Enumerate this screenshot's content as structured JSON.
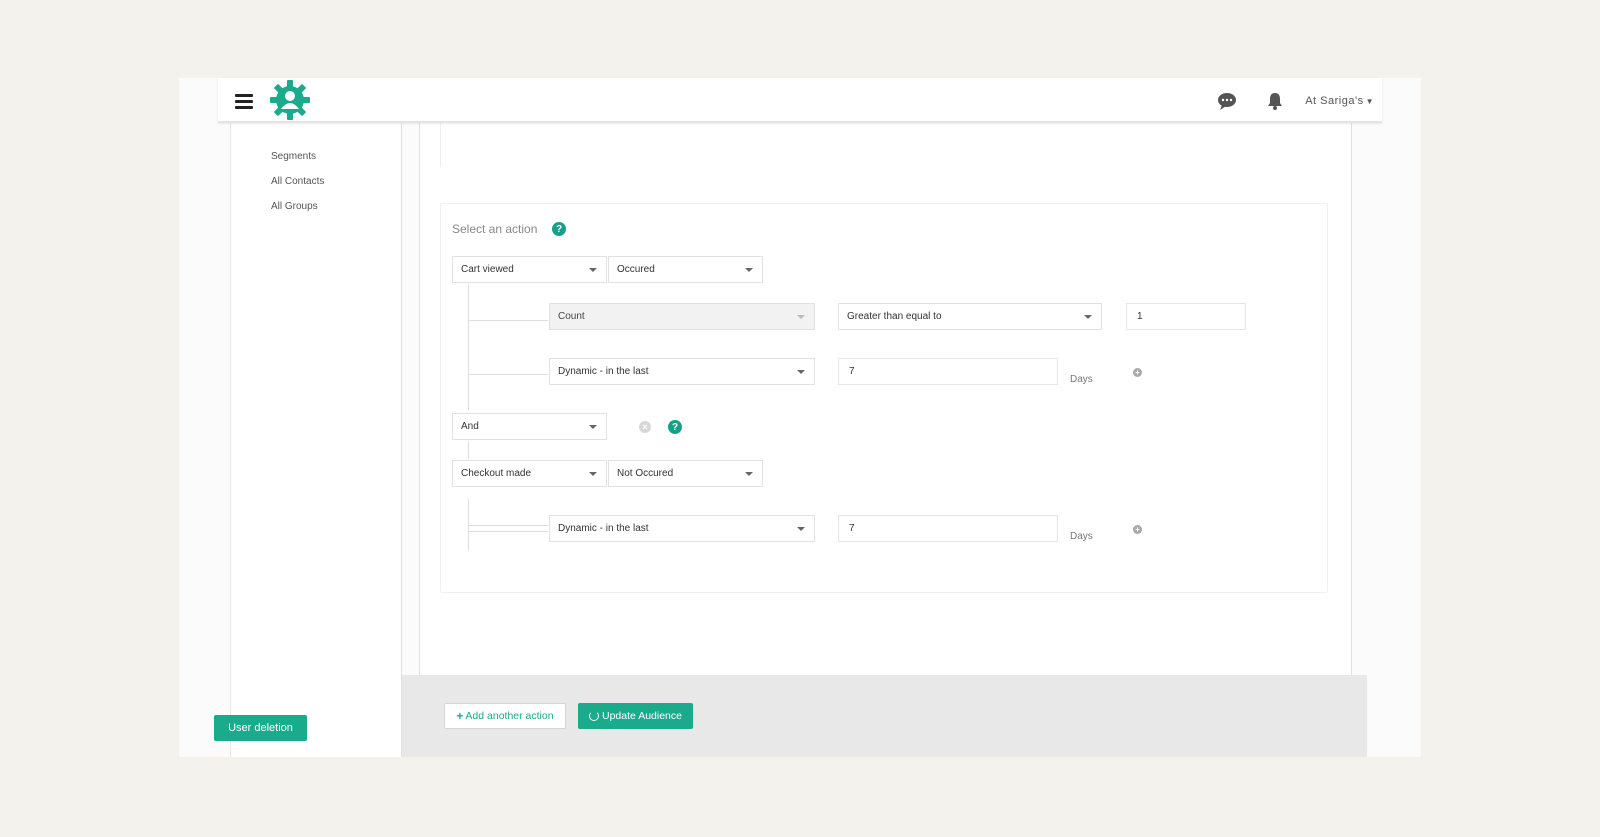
{
  "header": {
    "user_label": "At Sariga's",
    "icons": [
      "hamburger-menu-icon",
      "gear-logo",
      "chat-icon",
      "bell-icon"
    ],
    "brand_color": "#1aaa8c"
  },
  "sidebar": {
    "items": [
      {
        "label": "Segments"
      },
      {
        "label": "All Contacts"
      },
      {
        "label": "All Groups"
      }
    ],
    "user_deletion_label": "User deletion"
  },
  "builder": {
    "title": "Select an action",
    "action1": {
      "event": "Cart viewed",
      "occurrence": "Occured",
      "filter1": {
        "field": "Count",
        "operator": "Greater than equal to",
        "value": "1"
      },
      "filter2": {
        "field": "Dynamic - in the last",
        "value": "7",
        "unit": "Days"
      }
    },
    "connector": "And",
    "action2": {
      "event": "Checkout made",
      "occurrence": "Not Occured",
      "filter1": {
        "field": "Dynamic - in the last",
        "value": "7",
        "unit": "Days"
      }
    }
  },
  "footer": {
    "add_action_label": "Add another action",
    "update_label": "Update Audience"
  }
}
